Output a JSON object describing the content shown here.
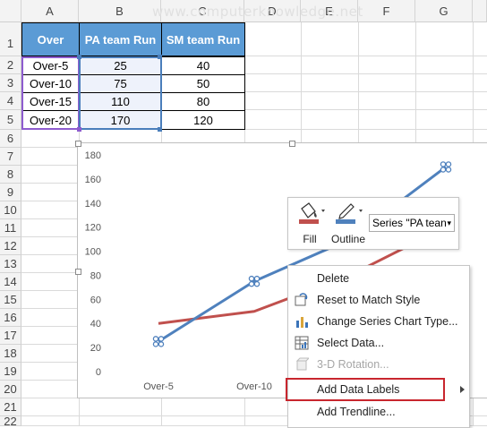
{
  "watermark": "www.computerknowledge.net",
  "columns": [
    "A",
    "B",
    "C",
    "D",
    "E",
    "F",
    "G"
  ],
  "rows": [
    "1",
    "2",
    "3",
    "4",
    "5",
    "6",
    "7",
    "8",
    "9",
    "10",
    "11",
    "12",
    "13",
    "14",
    "15",
    "16",
    "17",
    "18",
    "19",
    "20",
    "21",
    "22"
  ],
  "table": {
    "headers": [
      "Over",
      "PA team Run",
      "SM team Run"
    ],
    "data": [
      [
        "Over-5",
        "25",
        "40"
      ],
      [
        "Over-10",
        "75",
        "50"
      ],
      [
        "Over-15",
        "110",
        "80"
      ],
      [
        "Over-20",
        "170",
        "120"
      ]
    ]
  },
  "chart_data": {
    "type": "line",
    "categories": [
      "Over-5",
      "Over-10",
      "Over-15",
      "Over-20"
    ],
    "series": [
      {
        "name": "PA team Run",
        "values": [
          25,
          75,
          110,
          170
        ],
        "color": "#4f81bd",
        "selected": true
      },
      {
        "name": "SM team Run",
        "values": [
          40,
          50,
          80,
          120
        ],
        "color": "#c0504d"
      }
    ],
    "ylim": [
      0,
      180
    ],
    "yticks": [
      "0",
      "20",
      "40",
      "60",
      "80",
      "100",
      "120",
      "140",
      "160",
      "180"
    ],
    "visible_xticks": [
      "Over-5",
      "Over-10"
    ]
  },
  "mini_toolbar": {
    "fill_label": "Fill",
    "outline_label": "Outline",
    "series_dropdown": "Series \"PA tean",
    "fill_color": "#c0504d",
    "outline_color": "#4f81bd"
  },
  "context_menu": {
    "items": [
      {
        "label": "Delete",
        "icon": "none",
        "disabled": false
      },
      {
        "label": "Reset to Match Style",
        "icon": "reset-style-icon",
        "disabled": false
      },
      {
        "label": "Change Series Chart Type...",
        "icon": "chart-type-icon",
        "disabled": false
      },
      {
        "label": "Select Data...",
        "icon": "select-data-icon",
        "disabled": false
      },
      {
        "label": "3-D Rotation...",
        "icon": "rotation-icon",
        "disabled": true
      },
      {
        "label": "Add Data Labels",
        "icon": "none",
        "disabled": false,
        "submenu": true,
        "highlighted": true
      },
      {
        "label": "Add Trendline...",
        "icon": "none",
        "disabled": false
      }
    ]
  },
  "colors": {
    "header_fill": "#5b9bd5",
    "highlight_box": "#c8262e"
  }
}
